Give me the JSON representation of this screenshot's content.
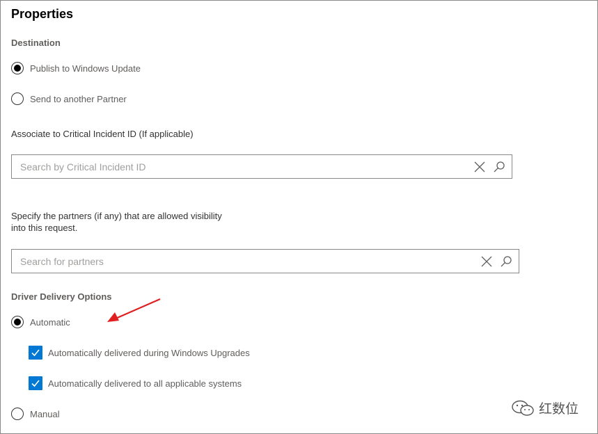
{
  "panel": {
    "title": "Properties"
  },
  "destination": {
    "label": "Destination",
    "options": [
      {
        "label": "Publish to Windows Update",
        "selected": true
      },
      {
        "label": "Send to another Partner",
        "selected": false
      }
    ]
  },
  "critical_incident": {
    "label": "Associate to Critical Incident ID (If applicable)",
    "placeholder": "Search by Critical Incident ID",
    "value": ""
  },
  "partners": {
    "label_line1": "Specify the partners (if any) that are allowed visibility",
    "label_line2": "into this request.",
    "placeholder": "Search for partners",
    "value": ""
  },
  "delivery": {
    "label": "Driver Delivery Options",
    "automatic_label": "Automatic",
    "automatic_selected": true,
    "sub_options": [
      {
        "label": "Automatically delivered during Windows Upgrades",
        "checked": true
      },
      {
        "label": "Automatically delivered to all applicable systems",
        "checked": true
      }
    ],
    "manual_label": "Manual",
    "manual_selected": false
  },
  "watermark": {
    "text": "红数位"
  },
  "colors": {
    "accent": "#0078d4",
    "annotation_arrow": "#e02020",
    "border": "#8a8886"
  }
}
